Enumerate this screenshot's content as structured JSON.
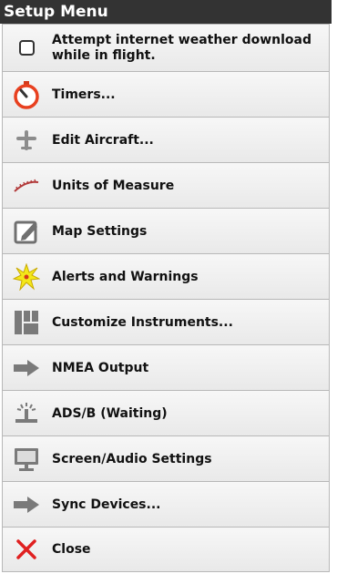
{
  "title": "Setup Menu",
  "menu": {
    "items": [
      {
        "label": "Attempt internet weather download while in flight.",
        "icon": "checkbox-icon",
        "checked": false
      },
      {
        "label": "Timers...",
        "icon": "stopwatch-icon"
      },
      {
        "label": "Edit Aircraft...",
        "icon": "airplane-icon"
      },
      {
        "label": "Units of Measure",
        "icon": "ruler-icon"
      },
      {
        "label": "Map Settings",
        "icon": "edit-icon"
      },
      {
        "label": "Alerts and Warnings",
        "icon": "alert-burst-icon"
      },
      {
        "label": "Customize Instruments...",
        "icon": "grid-icon"
      },
      {
        "label": "NMEA Output",
        "icon": "arrow-right-icon"
      },
      {
        "label": "ADS/B  (Waiting)",
        "icon": "antenna-icon"
      },
      {
        "label": "Screen/Audio Settings",
        "icon": "monitor-icon"
      },
      {
        "label": "Sync Devices...",
        "icon": "arrow-right-icon"
      },
      {
        "label": "Close",
        "icon": "close-icon"
      }
    ]
  },
  "colors": {
    "titlebar": "#333333",
    "accent_orange": "#e8401f",
    "close_red": "#e02020"
  }
}
